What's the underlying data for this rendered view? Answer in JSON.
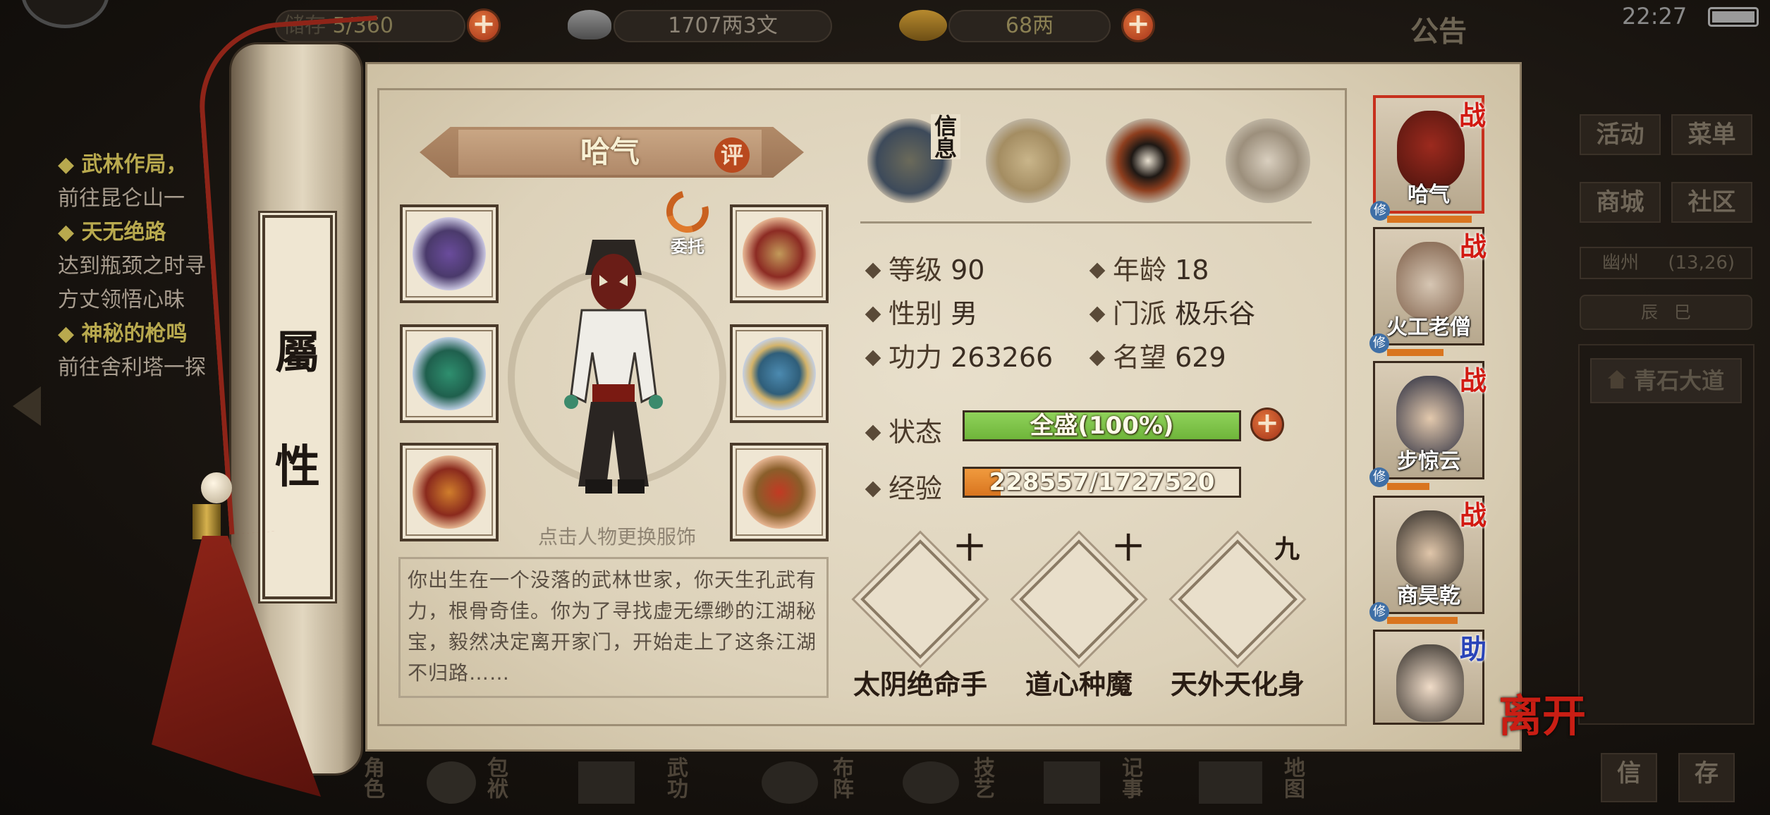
{
  "topbar": {
    "bag": {
      "label": "储存",
      "value": "5/360"
    },
    "silver": "1707两3文",
    "gold": "68两",
    "announcement": "公告",
    "time": "22:27"
  },
  "quests": [
    {
      "title": "◆ 武林作局，",
      "sub": "前往昆仑山一"
    },
    {
      "title": "◆ 天无绝路",
      "sub": "达到瓶颈之时寻"
    },
    {
      "title": "",
      "sub": "方丈领悟心昧"
    },
    {
      "title": "◆ 神秘的枪鸣",
      "sub": "前往舍利塔一探"
    }
  ],
  "scroll_tab": {
    "char1": "屬",
    "char2": "性"
  },
  "character": {
    "name": "哈气",
    "rate_label": "评",
    "entrust_label": "委托",
    "change_outfit_hint": "点击人物更换服饰",
    "bio": "你出生在一个没落的武林世家，你天生孔武有力，根骨奇佳。你为了寻找虚无缥缈的江湖秘宝，毅然决定离开家门，开始走上了这条江湖不归路……"
  },
  "info_tab_label": "信息",
  "stats": {
    "level_label": "等级",
    "level": "90",
    "age_label": "年龄",
    "age": "18",
    "gender_label": "性别",
    "gender": "男",
    "sect_label": "门派",
    "sect": "极乐谷",
    "power_label": "功力",
    "power": "263266",
    "fame_label": "名望",
    "fame": "629",
    "status_label": "状态",
    "status_text": "全盛(100%)",
    "status_fraction": 1.0,
    "exp_label": "经验",
    "exp_text": "228557/1727520",
    "exp_fraction": 0.1323
  },
  "skills": [
    {
      "name": "太阴绝命手",
      "level": "十"
    },
    {
      "name": "道心种魔",
      "level": "十"
    },
    {
      "name": "天外天化身",
      "level": "九"
    }
  ],
  "party": [
    {
      "name": "哈气",
      "tag": "战",
      "xiu": "修"
    },
    {
      "name": "火工老僧",
      "tag": "战",
      "xiu": "修"
    },
    {
      "name": "步惊云",
      "tag": "战",
      "xiu": "修"
    },
    {
      "name": "商昊乾",
      "tag": "战",
      "xiu": "修"
    },
    {
      "name": "",
      "tag": "助",
      "xiu": ""
    }
  ],
  "right_menu": {
    "activity": "活动",
    "menu": "菜单",
    "shop": "商城",
    "community": "社区",
    "location": "幽州",
    "coords": "(13,26)",
    "time_left": "辰",
    "time_right": "巳",
    "place": "青石大道",
    "btn1": "信",
    "btn2": "存"
  },
  "exit_label": "离开",
  "bottom_nav": [
    "角色",
    "包袱",
    "武功",
    "布阵",
    "技艺",
    "记事",
    "地图"
  ],
  "colors": {
    "status_bar": "#6fb53a",
    "exp_bar": "#d9751f",
    "tag_battle": "#d21a12",
    "tag_help": "#2a44b8"
  }
}
